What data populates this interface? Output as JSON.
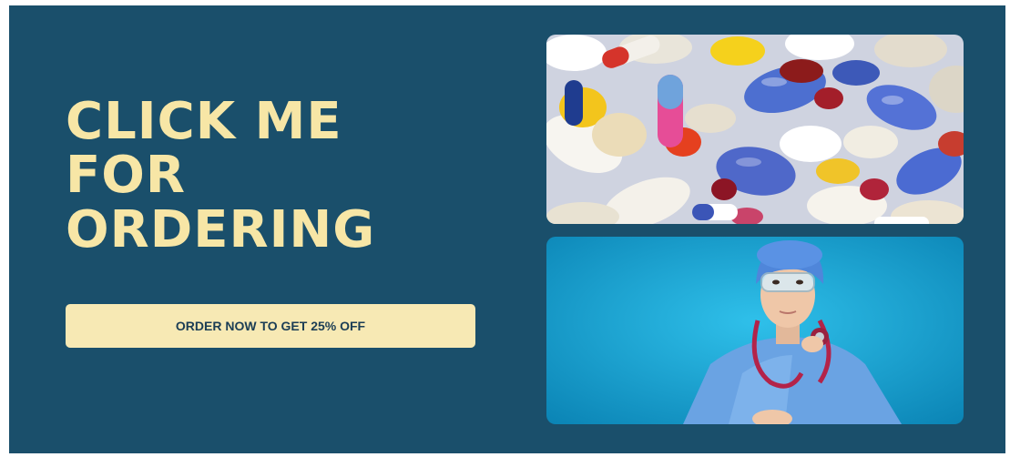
{
  "headline": {
    "line1": "CLICK ME",
    "line2": "FOR",
    "line3": "ORDERING"
  },
  "cta": {
    "label": "ORDER NOW TO GET 25% OFF"
  },
  "colors": {
    "background": "#1a4f6b",
    "headline": "#f7e6a6",
    "button": "#f7e9b4",
    "button_text": "#1b3d55"
  },
  "images": {
    "top": "pills-photo",
    "bottom": "nurse-with-stethoscope-photo"
  }
}
